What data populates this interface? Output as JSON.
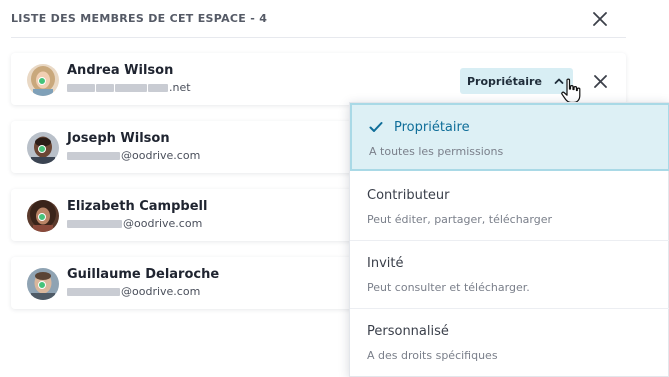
{
  "header": {
    "title": "LISTE DES MEMBRES DE CET ESPACE  - 4"
  },
  "members": [
    {
      "name": "Andrea Wilson",
      "email_suffix": ".net",
      "status": "online"
    },
    {
      "name": "Joseph Wilson",
      "email_suffix": "@oodrive.com",
      "status": "online"
    },
    {
      "name": "Elizabeth Campbell",
      "email_suffix": "@oodrive.com",
      "status": "online"
    },
    {
      "name": "Guillaume Delaroche",
      "email_suffix": "@oodrive.com",
      "status": "online"
    }
  ],
  "role_button": {
    "label": "Propriétaire"
  },
  "role_menu": {
    "options": [
      {
        "label": "Propriétaire",
        "description": "A toutes les permissions",
        "selected": true
      },
      {
        "label": "Contributeur",
        "description": "Peut éditer, partager, télécharger",
        "selected": false
      },
      {
        "label": "Invité",
        "description": "Peut consulter et télécharger.",
        "selected": false
      },
      {
        "label": "Personnalisé",
        "description": "A des droits spécifiques",
        "selected": false
      }
    ]
  },
  "colors": {
    "accent": "#0f6e99",
    "role_button_bg": "#d8eef4",
    "selected_option_bg": "#ddf0f5",
    "presence_online": "#45c37a"
  },
  "icons": {
    "close": "close-icon",
    "chevron": "chevron-up-icon",
    "check": "check-icon",
    "cursor": "hand-pointer-icon"
  }
}
